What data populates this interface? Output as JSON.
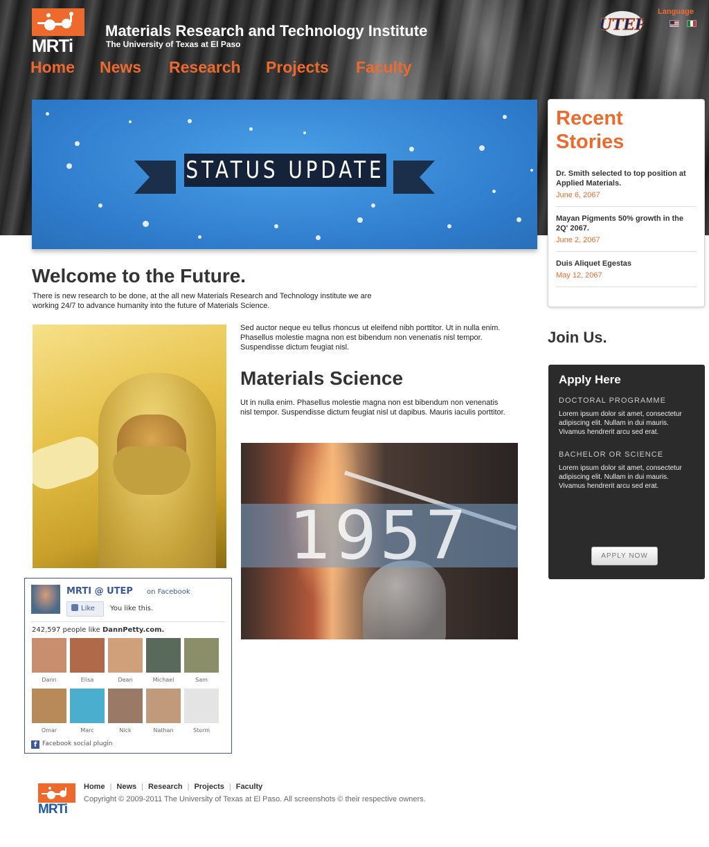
{
  "header": {
    "logo_text": "MRTi",
    "title": "Materials Research and Technology Institute",
    "subtitle": "The University of Texas at El Paso",
    "utep_logo_text": "UTEP",
    "language_label": "Language",
    "flags": [
      "us-flag-icon",
      "mexico-flag-icon"
    ]
  },
  "nav": {
    "items": [
      {
        "label": "Home"
      },
      {
        "label": "News"
      },
      {
        "label": "Research"
      },
      {
        "label": "Projects"
      },
      {
        "label": "Faculty"
      }
    ]
  },
  "banner": {
    "ribbon_text": "STATUS UPDATE"
  },
  "stories": {
    "title_line1": "Recent",
    "title_line2": "Stories",
    "items": [
      {
        "title": "Dr. Smith selected to top position at Applied Materials.",
        "date": "June 6, 2067"
      },
      {
        "title": "Mayan Pigments 50% growth in the 2Q' 2067.",
        "date": "June 2, 2067"
      },
      {
        "title": "Duis Aliquet Egestas",
        "date": "May 12, 2067"
      }
    ]
  },
  "welcome": {
    "heading": "Welcome to the Future.",
    "text": "There is new research to be done, at the all new Materials Research and Technology institute we are working 24/7 to advance humanity into the future of Materials Science."
  },
  "middle": {
    "para1": "Sed auctor neque eu tellus rhoncus ut eleifend nibh porttitor. Ut in nulla enim. Phasellus molestie magna non est bibendum non venenatis nisl tempor. Suspendisse dictum feugiat nisl.",
    "heading": "Materials Science",
    "para2": "Ut in nulla enim. Phasellus molestie magna non est bibendum non venenatis nisl tempor. Suspendisse dictum feugiat nisl ut dapibus. Mauris iaculis porttitor.",
    "photo_year": "1957"
  },
  "join": {
    "heading": "Join Us.",
    "box_title": "Apply Here",
    "programs": [
      {
        "name": "DOCTORAL PROGRAMME",
        "text": "Lorem ipsum dolor sit amet, consectetur adipiscing elit. Nullam in dui mauris. Vivamus hendrerit arcu sed erat."
      },
      {
        "name": "BACHELOR OR SCIENCE",
        "text": "Lorem ipsum dolor sit amet, consectetur adipiscing elit. Nullam in dui mauris. Vivamus hendrerit arcu sed erat."
      }
    ],
    "button_label": "APPLY NOW"
  },
  "facebook": {
    "page_name": "MRTI @ UTEP",
    "on_label": "on Facebook",
    "like_label": "Like",
    "you_like": "You like this.",
    "count_prefix": "242,597 people like",
    "count_site": "DannPetty.com.",
    "faces": [
      {
        "name": "Dann",
        "color": "#c88f6e"
      },
      {
        "name": "Elisa",
        "color": "#b06a4a"
      },
      {
        "name": "Dean",
        "color": "#d0a07a"
      },
      {
        "name": "Michael",
        "color": "#5a6a5a"
      },
      {
        "name": "Sam",
        "color": "#8a8f6a"
      },
      {
        "name": "Omar",
        "color": "#b88a5a"
      },
      {
        "name": "Marc",
        "color": "#4aaecf"
      },
      {
        "name": "Nick",
        "color": "#9a7a66"
      },
      {
        "name": "Nathan",
        "color": "#c09a7a"
      },
      {
        "name": "Storm",
        "color": "#e4e4e4"
      }
    ],
    "footer_label": "Facebook social plugin"
  },
  "footer": {
    "logo_text": "MRTi",
    "links": [
      "Home",
      "News",
      "Research",
      "Projects",
      "Faculty"
    ],
    "copyright": "Copyright © 2009-2011 The University of Texas at El Paso. All screenshots © their respective owners."
  },
  "colors": {
    "accent": "#ee6a2c",
    "banner_blue": "#3a8ad8",
    "dark_box": "#2b2b2b",
    "facebook_blue": "#3b5998"
  }
}
